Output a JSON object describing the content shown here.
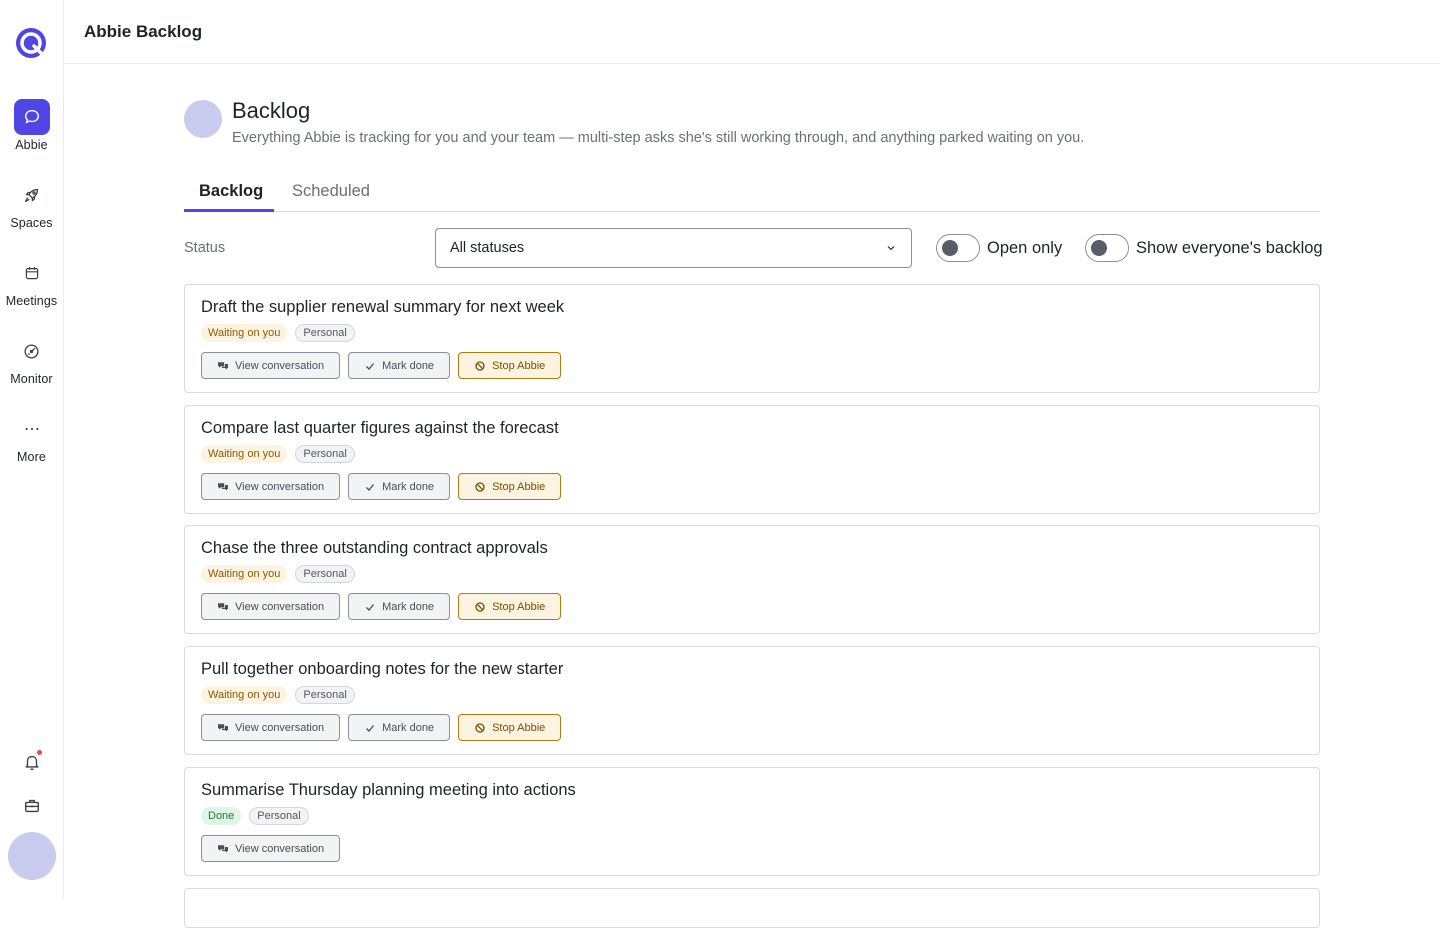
{
  "app": {
    "window_title": "Abbie Backlog"
  },
  "sidebar": {
    "items": [
      {
        "label": "Abbie",
        "icon": "chat-bubble-icon",
        "active": true
      },
      {
        "label": "Spaces",
        "icon": "rocket-icon",
        "active": false
      },
      {
        "label": "Meetings",
        "icon": "calendar-icon",
        "active": false
      },
      {
        "label": "Monitor",
        "icon": "gauge-icon",
        "active": false
      },
      {
        "label": "More",
        "icon": "ellipsis-icon",
        "active": false
      }
    ],
    "bottom_icons": [
      "bell-icon",
      "briefcase-icon"
    ],
    "notification_dot": true,
    "accent_color": "#4f46e5"
  },
  "page": {
    "title": "Backlog",
    "subtitle": "Everything Abbie is tracking for you and your team — multi-step asks she's still working through, and anything parked waiting on you."
  },
  "tabs": [
    {
      "label": "Backlog",
      "active": true
    },
    {
      "label": "Scheduled",
      "active": false
    }
  ],
  "filters": {
    "status_label": "Status",
    "status_value": "All statuses",
    "open_only_label": "Open only",
    "open_only_on": false,
    "show_everyone_label": "Show everyone's backlog",
    "show_everyone_on": false
  },
  "action_labels": {
    "view": "View conversation",
    "done": "Mark done",
    "stop": "Stop Abbie"
  },
  "tasks": [
    {
      "title": "Draft the supplier renewal summary for next week",
      "status": "Waiting on you",
      "status_kind": "waiting",
      "scope": "Personal"
    },
    {
      "title": "Compare last quarter figures against the forecast",
      "status": "Waiting on you",
      "status_kind": "waiting",
      "scope": "Personal"
    },
    {
      "title": "Chase the three outstanding contract approvals",
      "status": "Waiting on you",
      "status_kind": "waiting",
      "scope": "Personal"
    },
    {
      "title": "Pull together onboarding notes for the new starter",
      "status": "Waiting on you",
      "status_kind": "waiting",
      "scope": "Personal"
    },
    {
      "title": "Summarise Thursday planning meeting into actions",
      "status": "Done",
      "status_kind": "done",
      "scope": "Personal"
    }
  ]
}
